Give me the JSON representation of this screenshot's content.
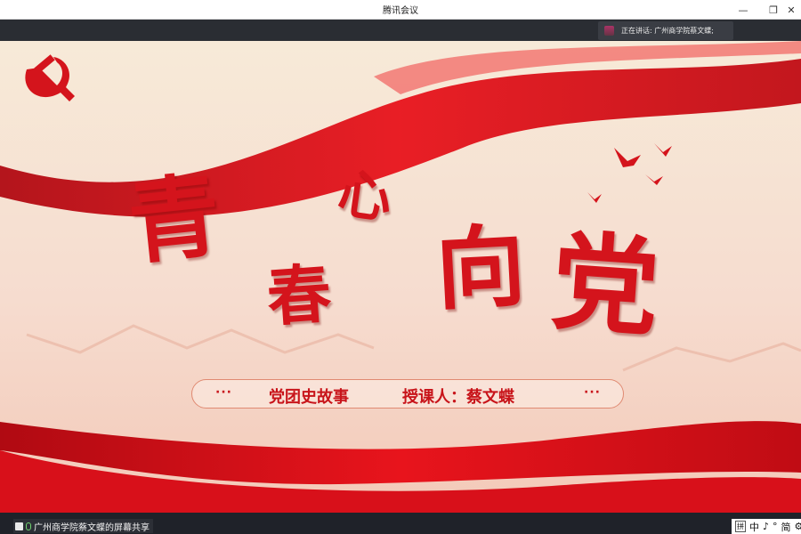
{
  "window": {
    "title": "腾讯会议",
    "minimize_glyph": "—",
    "restore_glyph": "❐",
    "close_glyph": "✕"
  },
  "speaker": {
    "text": "正在讲话: 广州商学院蔡文蝶;"
  },
  "slide": {
    "title_chars": [
      "青",
      "春",
      "心",
      "向",
      "党"
    ],
    "topic": "党团史故事",
    "teacher": "授课人：蔡文蝶",
    "dots": "···"
  },
  "share_status": {
    "text": "广州商学院蔡文蝶的屏幕共享"
  },
  "ime": {
    "items": [
      "拼",
      "中",
      "♪",
      "°",
      "简",
      "⚙"
    ]
  },
  "colors": {
    "party_red": "#d4141c",
    "ribbon_red": "#e0121a",
    "dark_bar": "#1f2229"
  }
}
